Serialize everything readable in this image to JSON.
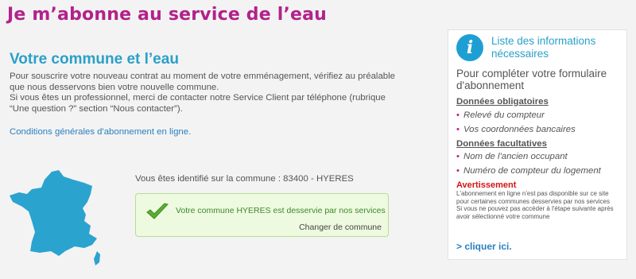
{
  "page": {
    "title": "Je m’abonne au service de l’eau"
  },
  "main": {
    "section_title": "Votre commune et l’eau",
    "intro_line1": "Pour souscrire votre nouveau contrat au moment de votre emménagement, vérifiez au préalable que nous desservons bien votre nouvelle commune.",
    "intro_line2": "Si vous êtes un professionnel, merci de contacter notre Service Client par téléphone (rubrique “Une question ?” section “Nous contacter”).",
    "conditions_link": "Conditions générales d'abonnement en ligne.",
    "identified_text": "Vous êtes identifié sur la commune : 83400 - HYERES",
    "commune_status": "Votre commune HYERES est desservie par nos services",
    "change_link": "Changer de commune"
  },
  "sidebar": {
    "title": "Liste des informations nécessaires",
    "subtitle": "Pour compléter votre formulaire d'abonnement",
    "required_heading": "Données obligatoires",
    "required_items": [
      "Relevé du compteur",
      "Vos coordonnées bancaires"
    ],
    "optional_heading": "Données facultatives",
    "optional_items": [
      "Nom de l'ancien occupant",
      "Numéro de compteur du logement"
    ],
    "warning_heading": "Avertissement",
    "warning_line1": "L'abonnement en ligne n'est pas disponible sur ce site pour certaines communes desservies par nos services",
    "warning_line2": "Si vous ne pouvez pas accéder à l'étape suivante après avoir sélectionné votre commune",
    "click_link": "> cliquer ici."
  },
  "icons": {
    "info": "info-icon",
    "check": "check-icon",
    "map": "france-map"
  },
  "colors": {
    "title": "#b2228b",
    "section": "#2aa0c9",
    "link": "#2a7fc0",
    "success_bg": "#eefadf",
    "warning": "#d21515"
  }
}
